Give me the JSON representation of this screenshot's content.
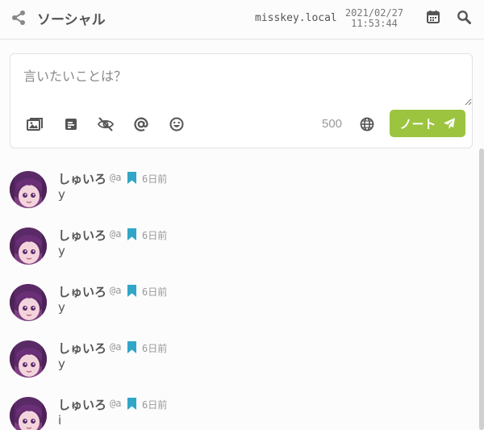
{
  "header": {
    "title": "ソーシャル",
    "host": "misskey.local",
    "date": "2021/02/27",
    "time": "11:53:44",
    "icons": [
      "share-icon",
      "calendar-icon",
      "search-icon"
    ]
  },
  "post_form": {
    "placeholder": "言いたいことは？",
    "value": "",
    "tools": [
      "image-icon",
      "poll-icon",
      "eye-slash-icon",
      "at-icon",
      "emoji-icon"
    ],
    "remaining": "500",
    "visibility_icon": "globe-icon",
    "submit_label": "ノート",
    "submit_icon": "paper-plane-icon",
    "accent_color": "#9cc43f"
  },
  "timeline": {
    "notes": [
      {
        "name": "しゅいろ",
        "acct": "@a",
        "time": "6日前",
        "text": "y"
      },
      {
        "name": "しゅいろ",
        "acct": "@a",
        "time": "6日前",
        "text": "y"
      },
      {
        "name": "しゅいろ",
        "acct": "@a",
        "time": "6日前",
        "text": "y"
      },
      {
        "name": "しゅいろ",
        "acct": "@a",
        "time": "6日前",
        "text": "y"
      },
      {
        "name": "しゅいろ",
        "acct": "@a",
        "time": "6日前",
        "text": "i"
      }
    ],
    "bookmark_color": "#31a6c7"
  }
}
